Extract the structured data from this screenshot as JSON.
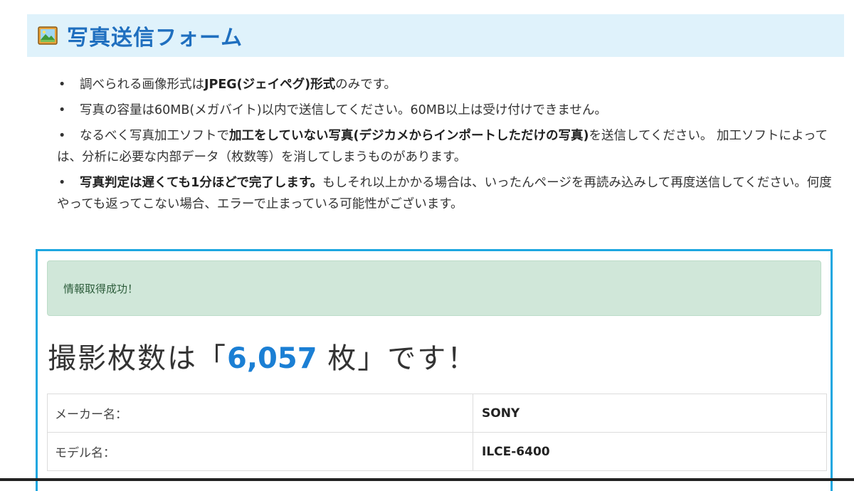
{
  "header": {
    "icon": "picture-icon",
    "title": "写真送信フォーム"
  },
  "notes": [
    {
      "parts": [
        {
          "text": "調べられる画像形式は",
          "bold": false
        },
        {
          "text": "JPEG(ジェイペグ)形式",
          "bold": true
        },
        {
          "text": "のみです。",
          "bold": false
        }
      ]
    },
    {
      "parts": [
        {
          "text": "写真の容量は60MB(メガバイト)以内で送信してください。60MB以上は受け付けできません。",
          "bold": false
        }
      ]
    },
    {
      "parts": [
        {
          "text": "なるべく写真加工ソフトで",
          "bold": false
        },
        {
          "text": "加工をしていない写真(デジカメからインポートしただけの写真)",
          "bold": true
        },
        {
          "text": "を送信してください。 加工ソフトによっては、分析に必要な内部データ（枚数等）を消してしまうものがあります。",
          "bold": false
        }
      ]
    },
    {
      "parts": [
        {
          "text": "写真判定は遅くても1分ほどで完了します。",
          "bold": true
        },
        {
          "text": "もしそれ以上かかる場合は、いったんページを再読み込みして再度送信してください。何度やっても返ってこない場合、エラーで止まっている可能性がございます。",
          "bold": false
        }
      ]
    }
  ],
  "result": {
    "alert": "情報取得成功！",
    "count_prefix": "撮影枚数は「",
    "count_value": "6,057",
    "count_suffix": " 枚」です！",
    "rows": [
      {
        "label": "メーカー名：",
        "value": "SONY"
      },
      {
        "label": "モデル名：",
        "value": "ILCE-6400"
      }
    ]
  }
}
